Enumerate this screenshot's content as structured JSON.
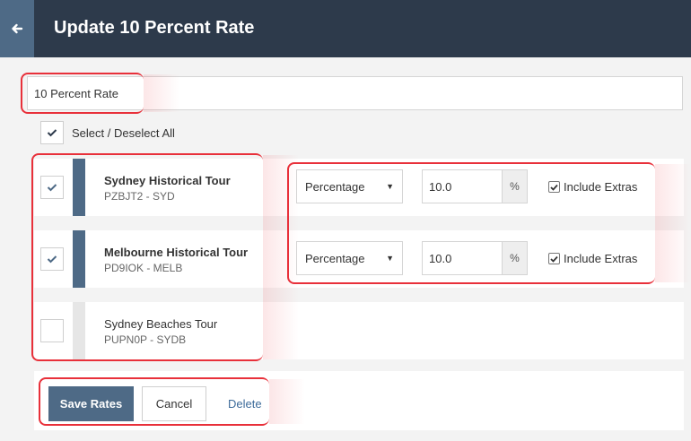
{
  "header": {
    "title": "Update 10 Percent Rate"
  },
  "rate_name": {
    "value": "10 Percent Rate"
  },
  "select_all": {
    "label": "Select / Deselect All",
    "checked": true
  },
  "tours": [
    {
      "name": "Sydney Historical Tour",
      "code": "PZBJT2 - SYD",
      "selected": true,
      "rate_type": "Percentage",
      "amount": "10.0",
      "unit": "%",
      "extras_label": "Include Extras",
      "extras_checked": true
    },
    {
      "name": "Melbourne Historical Tour",
      "code": "PD9IOK - MELB",
      "selected": true,
      "rate_type": "Percentage",
      "amount": "10.0",
      "unit": "%",
      "extras_label": "Include Extras",
      "extras_checked": true
    },
    {
      "name": "Sydney Beaches Tour",
      "code": "PUPN0P - SYDB",
      "selected": false
    }
  ],
  "footer": {
    "save_label": "Save Rates",
    "cancel_label": "Cancel",
    "delete_label": "Delete"
  },
  "colors": {
    "header_bg": "#2d3a4b",
    "accent": "#4e6a86",
    "highlight": "#e8303a",
    "link": "#3d6b9a"
  }
}
